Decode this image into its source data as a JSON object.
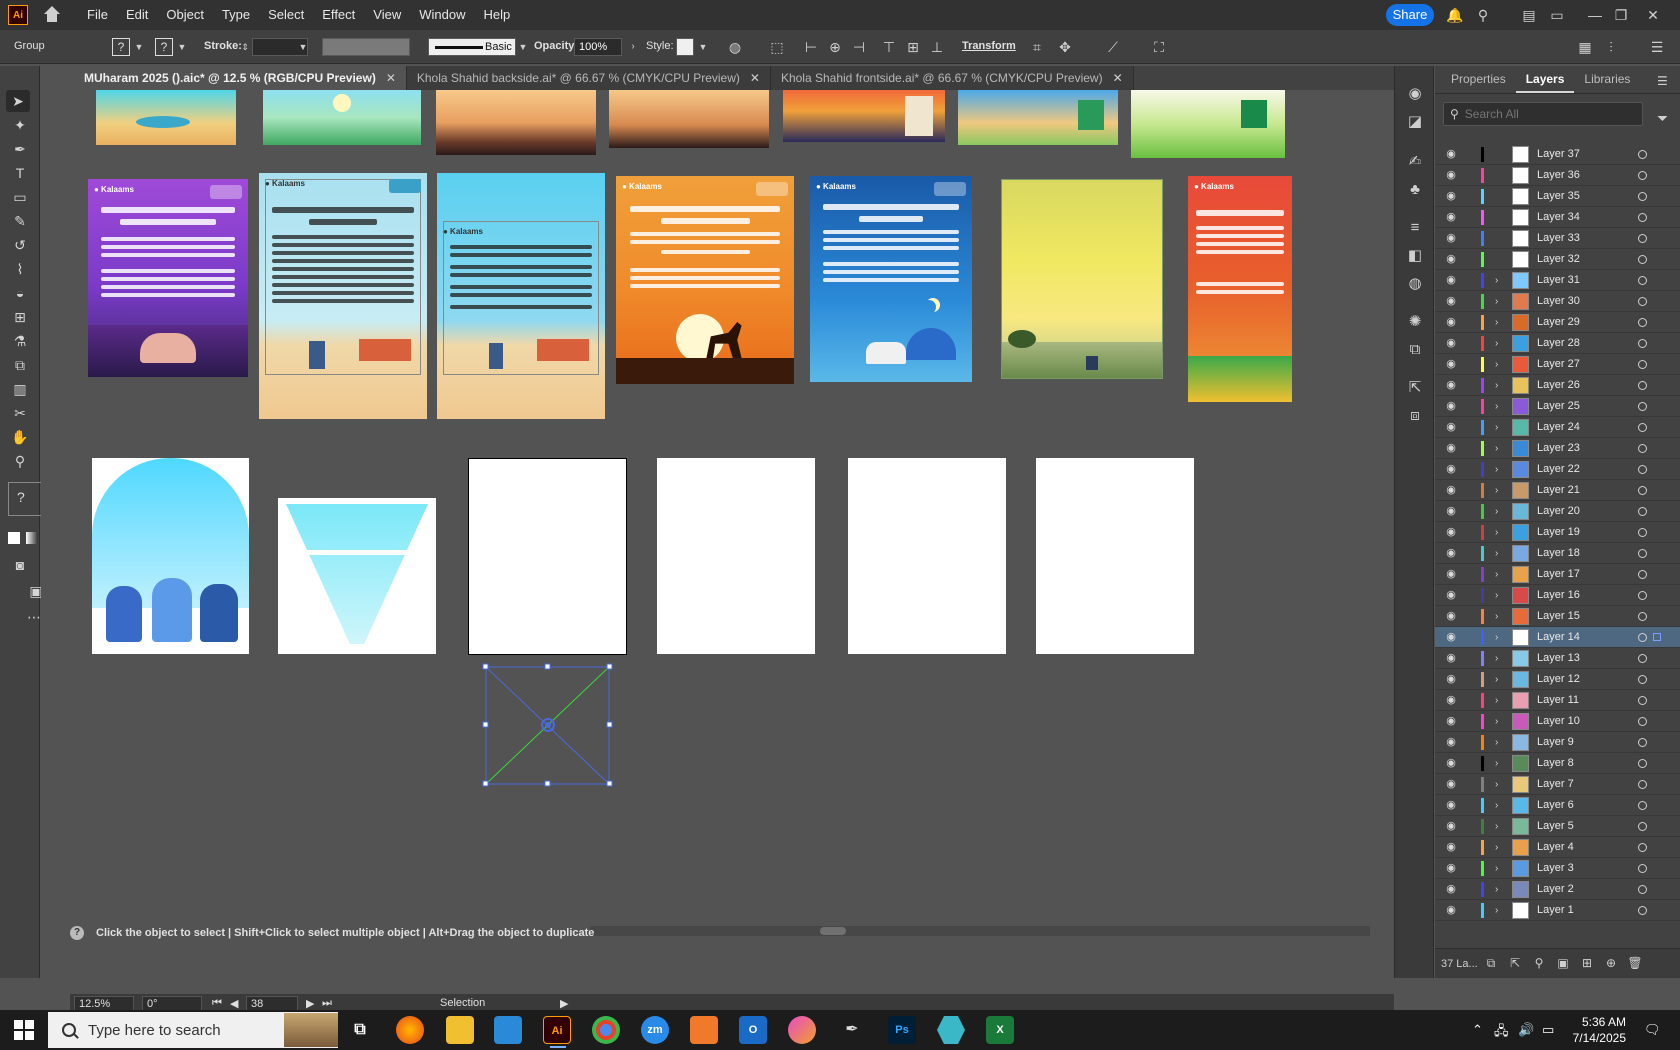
{
  "menubar": {
    "app_logo": "Ai",
    "items": [
      "File",
      "Edit",
      "Object",
      "Type",
      "Select",
      "Effect",
      "View",
      "Window",
      "Help"
    ],
    "share_label": "Share"
  },
  "controlbar": {
    "selection_type": "Group",
    "stroke_label": "Stroke:",
    "brush_label": "Basic",
    "opacity_label": "Opacity:",
    "opacity_value": "100%",
    "style_label": "Style:",
    "transform_label": "Transform"
  },
  "tabs": [
    {
      "label": "MUharam 2025 ().aic* @ 12.5 % (RGB/CPU Preview)",
      "active": true
    },
    {
      "label": "Khola Shahid backside.ai* @ 66.67 % (CMYK/CPU Preview)",
      "active": false
    },
    {
      "label": "Khola Shahid frontside.ai* @ 66.67 % (CMYK/CPU Preview)",
      "active": false
    }
  ],
  "panel": {
    "tabs": [
      "Properties",
      "Layers",
      "Libraries"
    ],
    "active_tab": "Layers",
    "search_placeholder": "Search All",
    "layers": [
      {
        "name": "Layer 37",
        "color": "#000000",
        "thumb": "#ffffff",
        "expandable": false
      },
      {
        "name": "Layer 36",
        "color": "#ff3fa0",
        "thumb": "#ffffff",
        "expandable": false
      },
      {
        "name": "Layer 35",
        "color": "#4fd8ff",
        "thumb": "#ffffff",
        "expandable": false
      },
      {
        "name": "Layer 34",
        "color": "#ff4fff",
        "thumb": "#ffffff",
        "expandable": false
      },
      {
        "name": "Layer 33",
        "color": "#3f7fff",
        "thumb": "#ffffff",
        "expandable": false
      },
      {
        "name": "Layer 32",
        "color": "#4fff4f",
        "thumb": "#ffffff",
        "expandable": false
      },
      {
        "name": "Layer 31",
        "color": "#3f3fff",
        "thumb": "#7ec8ff",
        "expandable": true
      },
      {
        "name": "Layer 30",
        "color": "#3fdd3f",
        "thumb": "#e07a4f",
        "expandable": true
      },
      {
        "name": "Layer 29",
        "color": "#ff9f3f",
        "thumb": "#d86a2a",
        "expandable": true
      },
      {
        "name": "Layer 28",
        "color": "#ff3f3f",
        "thumb": "#3aa0e0",
        "expandable": true
      },
      {
        "name": "Layer 27",
        "color": "#ffff3f",
        "thumb": "#e85a3a",
        "expandable": true
      },
      {
        "name": "Layer 26",
        "color": "#9f3fff",
        "thumb": "#e8c25a",
        "expandable": true
      },
      {
        "name": "Layer 25",
        "color": "#ff3f9f",
        "thumb": "#8a5ad8",
        "expandable": true
      },
      {
        "name": "Layer 24",
        "color": "#3f9fff",
        "thumb": "#5ab8a8",
        "expandable": true
      },
      {
        "name": "Layer 23",
        "color": "#9fff3f",
        "thumb": "#3a8ad8",
        "expandable": true
      },
      {
        "name": "Layer 22",
        "color": "#3f3fcf",
        "thumb": "#5a8ae0",
        "expandable": true
      },
      {
        "name": "Layer 21",
        "color": "#cf7f3f",
        "thumb": "#c89a6a",
        "expandable": true
      },
      {
        "name": "Layer 20",
        "color": "#3fcf3f",
        "thumb": "#6ab8d8",
        "expandable": true
      },
      {
        "name": "Layer 19",
        "color": "#cf3f3f",
        "thumb": "#3aa0e0",
        "expandable": true
      },
      {
        "name": "Layer 18",
        "color": "#3fcfcf",
        "thumb": "#7aa8e0",
        "expandable": true
      },
      {
        "name": "Layer 17",
        "color": "#7f3fcf",
        "thumb": "#e8a24a",
        "expandable": true
      },
      {
        "name": "Layer 16",
        "color": "#3f3f9f",
        "thumb": "#d84a4a",
        "expandable": true
      },
      {
        "name": "Layer 15",
        "color": "#ff7f3f",
        "thumb": "#e86a3a",
        "expandable": true
      },
      {
        "name": "Layer 14",
        "color": "#3f5fff",
        "thumb": "#ffffff",
        "expandable": true,
        "selected": true
      },
      {
        "name": "Layer 13",
        "color": "#7f7fff",
        "thumb": "#8ac8e8",
        "expandable": true
      },
      {
        "name": "Layer 12",
        "color": "#cf9f7f",
        "thumb": "#6ab8e0",
        "expandable": true
      },
      {
        "name": "Layer 11",
        "color": "#ff3f7f",
        "thumb": "#e8a0b0",
        "expandable": true
      },
      {
        "name": "Layer 10",
        "color": "#ff3fcf",
        "thumb": "#c85ab8",
        "expandable": true
      },
      {
        "name": "Layer 9",
        "color": "#ff7f00",
        "thumb": "#8ab8e0",
        "expandable": true
      },
      {
        "name": "Layer 8",
        "color": "#000000",
        "thumb": "#5a8a5a",
        "expandable": true
      },
      {
        "name": "Layer 7",
        "color": "#7f7f7f",
        "thumb": "#e8c87a",
        "expandable": true
      },
      {
        "name": "Layer 6",
        "color": "#3fcfff",
        "thumb": "#5ab8e8",
        "expandable": true
      },
      {
        "name": "Layer 5",
        "color": "#3f7f3f",
        "thumb": "#7ab89a",
        "expandable": true
      },
      {
        "name": "Layer 4",
        "color": "#ff9f3f",
        "thumb": "#e8a04a",
        "expandable": true
      },
      {
        "name": "Layer 3",
        "color": "#3fff3f",
        "thumb": "#5a9ae0",
        "expandable": true
      },
      {
        "name": "Layer 2",
        "color": "#3f3fff",
        "thumb": "#7a8ab8",
        "expandable": true
      },
      {
        "name": "Layer 1",
        "color": "#3fcfff",
        "thumb": "#ffffff",
        "expandable": true
      }
    ],
    "footer_count": "37 La..."
  },
  "hint": {
    "text": "Click the object to select  |  Shift+Click to select multiple object  |  Alt+Drag the object to duplicate"
  },
  "statusbar": {
    "zoom": "12.5%",
    "rotation": "0°",
    "artboard": "38",
    "tool": "Selection"
  },
  "taskbar": {
    "search_placeholder": "Type here to search",
    "time": "5:36 AM",
    "date": "7/14/2025",
    "apps": [
      "firefox",
      "file-explorer",
      "vscode",
      "illustrator",
      "chrome",
      "zoom",
      "xampp",
      "outlook",
      "adobe-cc",
      "pen-tool",
      "photoshop",
      "app-hex",
      "excel"
    ]
  }
}
